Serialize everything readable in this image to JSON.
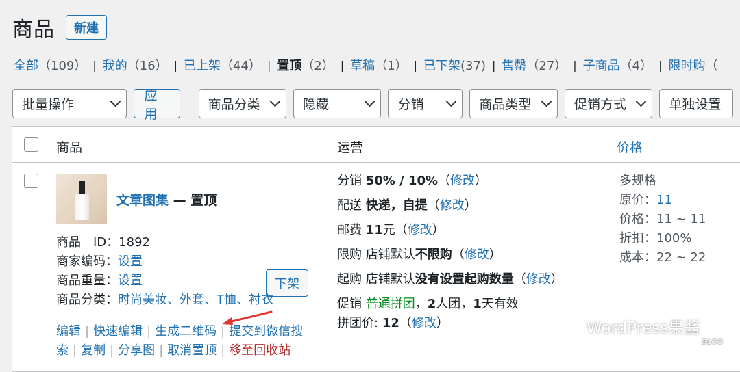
{
  "header": {
    "title": "商品",
    "new_label": "新建"
  },
  "filters": [
    {
      "label": "全部",
      "count": "（109）",
      "current": false
    },
    {
      "label": "我的",
      "count": "（16）",
      "current": false
    },
    {
      "label": "已上架",
      "count": "（44）",
      "current": false
    },
    {
      "label": "置顶",
      "count": "（2）",
      "current": true
    },
    {
      "label": "草稿",
      "count": "（1）",
      "current": false
    },
    {
      "label": "已下架",
      "count": "(37)",
      "current": false
    },
    {
      "label": "售罄",
      "count": "（27）",
      "current": false
    },
    {
      "label": "子商品",
      "count": "（4）",
      "current": false
    },
    {
      "label": "限时购",
      "count": "（",
      "current": false
    }
  ],
  "toolbar": {
    "bulk_action": "批量操作",
    "apply_label": "应用",
    "category": "商品分类",
    "visibility": "隐藏",
    "distribution": "分销",
    "product_type": "商品类型",
    "promotion": "促销方式",
    "standalone": "单独设置"
  },
  "table": {
    "headers": {
      "name": "商品",
      "ops": "运营",
      "price": "价格"
    }
  },
  "product": {
    "title": "文章图集",
    "state": " — 置顶",
    "unlist_label": "下架",
    "meta": {
      "id_label": "商品　ID：",
      "id_value": "1892",
      "sku_label": "商家编码：",
      "sku_value": "设置",
      "weight_label": "商品重量：",
      "weight_value": "设置",
      "category_label": "商品分类：",
      "categories": "时尚美妆、外套、T恤、衬衣"
    },
    "actions_row1": [
      "编辑",
      "快速编辑",
      "生成二维码",
      "提交到微信搜"
    ],
    "actions_row2": [
      "索",
      "复制",
      "分享图",
      "取消置顶"
    ],
    "trash_label": "移至回收站",
    "ops": {
      "dist_label": "分销",
      "dist_value": "50% / 10%",
      "delivery_label": "配送",
      "delivery_value": "快递，自提",
      "shipping_label": "邮费",
      "shipping_value": "11",
      "shipping_unit": "元",
      "limit_label": "限购",
      "limit_prefix": "店铺默认",
      "limit_value": "不限购",
      "min_label": "起购",
      "min_prefix": "店铺默认",
      "min_value": "没有设置起购数量",
      "promo_label": "促销",
      "promo_value": "普通拼团",
      "promo_group_num": "2",
      "promo_group_text": "人团，",
      "promo_days_num": "1",
      "promo_days_text": "天有效",
      "group_price_label": "拼团价: ",
      "group_price_value": "12",
      "edit_open": "（",
      "edit_label": "修改",
      "edit_close": "）"
    },
    "price": {
      "spec": "多规格",
      "original_label": "原价：",
      "original_value": "11",
      "price_label": "价格：",
      "price_value": "11 ~ 11",
      "discount_label": "折扣：",
      "discount_value": "100%",
      "cost_label": "成本：",
      "cost_value": "22 ~ 22"
    }
  },
  "watermark": {
    "text": "WordPress果酱",
    "sub": "BLOG"
  },
  "colors": {
    "link": "#2271b1",
    "danger": "#b32d2e",
    "success": "#008a20",
    "arrow": "#e3342f"
  }
}
